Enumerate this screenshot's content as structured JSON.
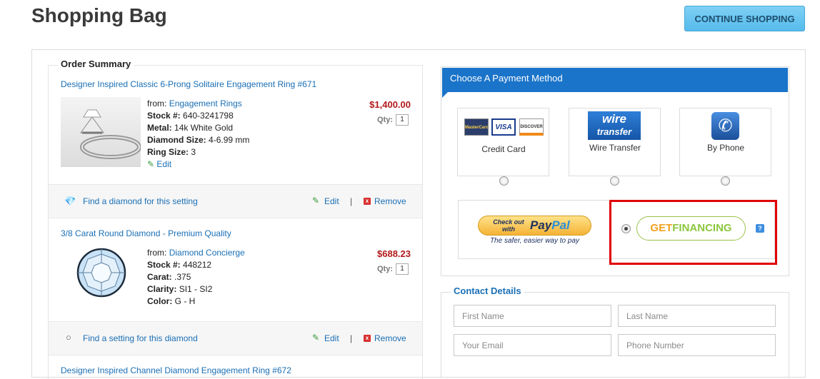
{
  "page": {
    "title": "Shopping Bag",
    "continue_label": "CONTINUE SHOPPING"
  },
  "order_summary": {
    "title": "Order Summary",
    "items": [
      {
        "name": "Designer Inspired Classic 6-Prong Solitaire Engagement Ring #671",
        "from_label": "from:",
        "from_link": "Engagement Rings",
        "details": [
          {
            "label": "Stock #:",
            "value": "640-3241798"
          },
          {
            "label": "Metal:",
            "value": "14k White Gold"
          },
          {
            "label": "Diamond Size:",
            "value": "4-6.99 mm"
          },
          {
            "label": "Ring Size:",
            "value": "3"
          }
        ],
        "edit_inline": "Edit",
        "price": "$1,400.00",
        "qty_label": "Qty:",
        "qty": "1",
        "footer_link": "Find a diamond for this setting",
        "edit": "Edit",
        "separator": "|",
        "remove": "Remove"
      },
      {
        "name": "3/8 Carat Round Diamond - Premium Quality",
        "from_label": "from:",
        "from_link": "Diamond Concierge",
        "details": [
          {
            "label": "Stock #:",
            "value": "448212"
          },
          {
            "label": "Carat:",
            "value": ".375"
          },
          {
            "label": "Clarity:",
            "value": "SI1 - SI2"
          },
          {
            "label": "Color:",
            "value": "G - H"
          }
        ],
        "price": "$688.23",
        "qty_label": "Qty:",
        "qty": "1",
        "footer_link": "Find a setting for this diamond",
        "edit": "Edit",
        "separator": "|",
        "remove": "Remove"
      }
    ],
    "next_item_partial": "Designer Inspired Channel Diamond Engagement Ring #672"
  },
  "payment": {
    "title": "Choose A Payment Method",
    "options": [
      {
        "label": "Credit Card",
        "card_logos": [
          "MasterCard",
          "VISA",
          "DISCOVER"
        ]
      },
      {
        "label": "Wire Transfer",
        "logo_top": "wire",
        "logo_bottom": "transfer"
      },
      {
        "label": "By Phone"
      }
    ],
    "paypal": {
      "line1": "Check out",
      "line2": "with",
      "brand_a": "Pay",
      "brand_b": "Pal",
      "tagline": "The safer, easier way to pay"
    },
    "financing": {
      "brand_a": "GET",
      "brand_b": "FINANCING",
      "help": "?"
    }
  },
  "contact": {
    "title": "Contact Details",
    "first_name": "First Name",
    "last_name": "Last Name",
    "email": "Your Email",
    "phone": "Phone Number"
  },
  "colors": {
    "accent": "#1a74c9",
    "price": "#b3191b",
    "link": "#1a6fb5",
    "highlight": "#e00000"
  }
}
